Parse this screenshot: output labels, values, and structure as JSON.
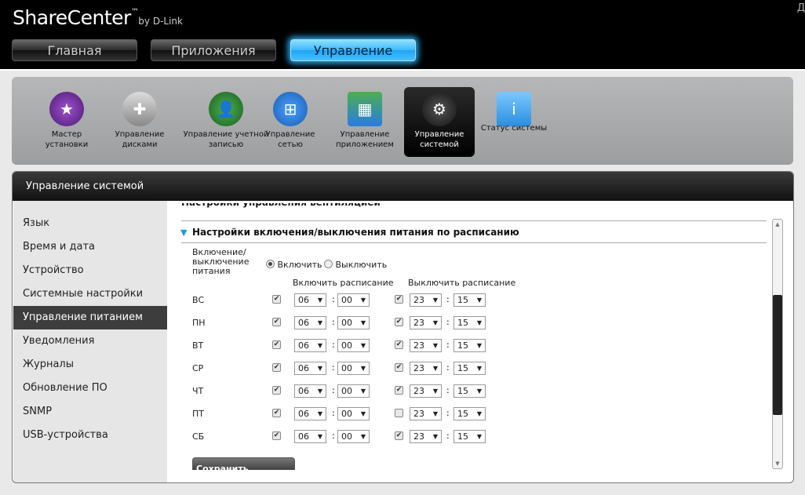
{
  "app": {
    "logo": "ShareCenter",
    "logo_tm": "™",
    "logo_by": "by D-Link",
    "corner_text": "Д"
  },
  "tabs": [
    {
      "label": "Главная"
    },
    {
      "label": "Приложения"
    },
    {
      "label": "Управление"
    }
  ],
  "toolbar": [
    {
      "label": "Мастер установки",
      "icon": "wizard-hat-icon"
    },
    {
      "label": "Управление дисками",
      "icon": "disk-icon"
    },
    {
      "label": "Управление учетной записью",
      "icon": "users-icon"
    },
    {
      "label": "Управление сетью",
      "icon": "network-icon"
    },
    {
      "label": "Управление приложением",
      "icon": "apps-grid-icon"
    },
    {
      "label": "Управление системой",
      "icon": "system-gear-icon"
    },
    {
      "label": "Статус системы",
      "icon": "info-icon"
    }
  ],
  "panel": {
    "title": "Управление системой"
  },
  "sidebar": [
    "Язык",
    "Время и дата",
    "Устройство",
    "Системные настройки",
    "Управление питанием",
    "Уведомления",
    "Журналы",
    "Обновление ПО",
    "SNMP",
    "USB-устройства"
  ],
  "content": {
    "prev_section": "Настройки управления вентиляцией",
    "section": "Настройки включения/выключения питания по расписанию",
    "power_label": "Включение/ выключение питания",
    "radio_on": "Включить",
    "radio_off": "Выключить",
    "radio_selected": "on",
    "col_on": "Включить расписание",
    "col_off": "Выключить расписание",
    "rows": [
      {
        "day": "ВС",
        "on_checked": true,
        "on_h": "06",
        "on_m": "00",
        "off_checked": true,
        "off_h": "23",
        "off_m": "15"
      },
      {
        "day": "ПН",
        "on_checked": true,
        "on_h": "06",
        "on_m": "00",
        "off_checked": true,
        "off_h": "23",
        "off_m": "15"
      },
      {
        "day": "ВТ",
        "on_checked": true,
        "on_h": "06",
        "on_m": "00",
        "off_checked": true,
        "off_h": "23",
        "off_m": "15"
      },
      {
        "day": "СР",
        "on_checked": true,
        "on_h": "06",
        "on_m": "00",
        "off_checked": true,
        "off_h": "23",
        "off_m": "15"
      },
      {
        "day": "ЧТ",
        "on_checked": true,
        "on_h": "06",
        "on_m": "00",
        "off_checked": true,
        "off_h": "23",
        "off_m": "15"
      },
      {
        "day": "ПТ",
        "on_checked": true,
        "on_h": "06",
        "on_m": "00",
        "off_checked": false,
        "off_h": "23",
        "off_m": "15"
      },
      {
        "day": "СБ",
        "on_checked": true,
        "on_h": "06",
        "on_m": "00",
        "off_checked": true,
        "off_h": "23",
        "off_m": "15"
      }
    ],
    "colon": ":",
    "save_label": "Сохранить настройки"
  },
  "colors": {
    "accent": "#2aa8e8",
    "active_dark": "#3d3d3d"
  }
}
